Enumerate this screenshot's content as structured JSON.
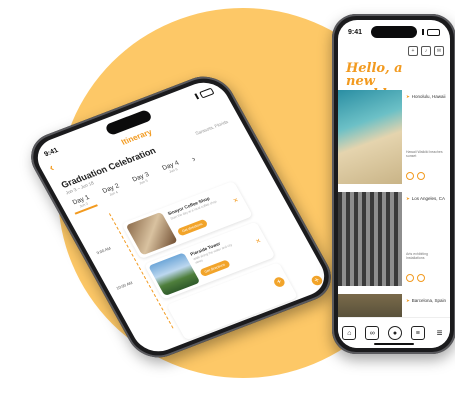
{
  "colors": {
    "accent": "#F29A1F",
    "background_circle": "#FDC867"
  },
  "itinerary": {
    "status_time": "9:41",
    "header_title": "Itinerary",
    "trip_title": "Graduation Celebration",
    "trip_dates": "Jun 3 – Jun 18",
    "trip_location": "Sarasota, Florida",
    "days": [
      {
        "label": "Day 1",
        "sub": "Jun 3"
      },
      {
        "label": "Day 2",
        "sub": "Jun 4"
      },
      {
        "label": "Day 3",
        "sub": "Jun 5"
      },
      {
        "label": "Day 4",
        "sub": "Jun 6"
      }
    ],
    "stops": [
      {
        "time": "9:00 AM",
        "name": "Sinayor Coffee Shop",
        "desc": "Start the day at a local coffee shop",
        "action": "Get directions"
      },
      {
        "time": "10:00 AM",
        "name": "Pierside Tower",
        "desc": "Walk along the water and city views",
        "action": "Get directions"
      }
    ],
    "icons": {
      "back": "back-arrow-icon",
      "next": "chevron-right-icon",
      "remove": "close-icon",
      "add": "plus-icon"
    }
  },
  "feed": {
    "status_time": "9:41",
    "greeting": "Hello, a new world",
    "posts": [
      {
        "location": "Honolulu, Hawaii",
        "title": "Hawaii Waikiki beaches sunset"
      },
      {
        "location": "Los Angeles, CA",
        "title": "Arts exhibiting Installations"
      },
      {
        "location": "Barcelona, Spain",
        "title": ""
      }
    ],
    "nav": [
      "home-icon",
      "binoculars-icon",
      "profile-icon",
      "journal-icon",
      "menu-icon"
    ]
  }
}
